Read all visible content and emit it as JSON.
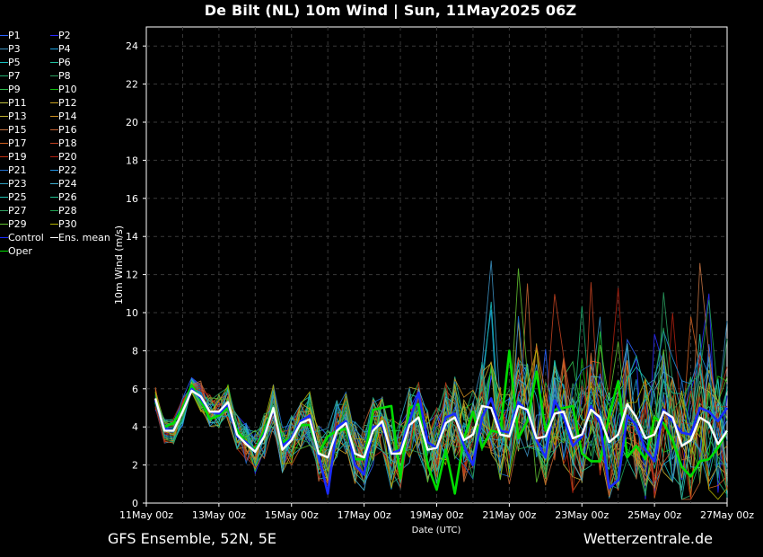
{
  "header": {
    "title": "De Bilt  (NL)  10m Wind | Sun, 11May2025 06Z"
  },
  "footer": {
    "left": "GFS Ensemble, 52N, 5E",
    "right": "Wetterzentrale.de"
  },
  "colors": {
    "background": "#000000",
    "grid": "#3a3a3a",
    "axis": "#ffffff",
    "control": "#1a2cff",
    "ensmean": "#ffffff",
    "oper": "#00dd00"
  },
  "chart_data": {
    "type": "line",
    "title": "De Bilt  (NL)  10m Wind | Sun, 11May2025 06Z",
    "xlabel": "Date (UTC)",
    "ylabel": "10m Wind (m/s)",
    "ylim": [
      0,
      25
    ],
    "y_ticks": [
      0,
      2,
      4,
      6,
      8,
      10,
      12,
      14,
      16,
      18,
      20,
      22,
      24
    ],
    "xlim": [
      0,
      64
    ],
    "x_unit": "6-hourly steps from 11May 00z",
    "x_ticks": [
      {
        "x": 0,
        "label": "11May 00z"
      },
      {
        "x": 8,
        "label": "13May 00z"
      },
      {
        "x": 16,
        "label": "15May 00z"
      },
      {
        "x": 24,
        "label": "17May 00z"
      },
      {
        "x": 32,
        "label": "19May 00z"
      },
      {
        "x": 40,
        "label": "21May 00z"
      },
      {
        "x": 48,
        "label": "23May 00z"
      },
      {
        "x": 56,
        "label": "25May 00z"
      },
      {
        "x": 64,
        "label": "27May 00z"
      }
    ],
    "grid": true,
    "legend_position": "left outside",
    "series": [
      {
        "name": "Ens. mean",
        "color": "#ffffff",
        "width": 2.4,
        "x": [
          1,
          2,
          3,
          4,
          5,
          6,
          7,
          8,
          9,
          10,
          11,
          12,
          13,
          14,
          15,
          16,
          17,
          18,
          19,
          20,
          21,
          22,
          23,
          24,
          25,
          26,
          27,
          28,
          29,
          30,
          31,
          32,
          33,
          34,
          35,
          36,
          37,
          38,
          39,
          40,
          41,
          42,
          43,
          44,
          45,
          46,
          47,
          48,
          49,
          50,
          51,
          52,
          53,
          54,
          55,
          56,
          57,
          58,
          59,
          60,
          61,
          62,
          63,
          64
        ],
        "values": [
          5.5,
          3.8,
          3.8,
          4.8,
          5.9,
          5.6,
          4.8,
          4.8,
          5.3,
          3.6,
          3.1,
          2.7,
          3.5,
          5.0,
          2.8,
          3.3,
          4.2,
          4.4,
          2.6,
          2.4,
          3.8,
          4.2,
          2.6,
          2.4,
          3.8,
          4.3,
          2.6,
          2.6,
          4.1,
          4.5,
          2.8,
          2.9,
          4.2,
          4.5,
          3.3,
          3.6,
          5.1,
          5.0,
          3.6,
          3.5,
          5.1,
          4.9,
          3.4,
          3.5,
          4.7,
          4.8,
          3.4,
          3.6,
          4.9,
          4.5,
          3.2,
          3.6,
          5.2,
          4.5,
          3.4,
          3.6,
          4.8,
          4.5,
          3.0,
          3.3,
          4.5,
          4.2,
          3.1,
          3.8
        ]
      },
      {
        "name": "Control",
        "color": "#1a2cff",
        "width": 2.6,
        "x": [
          1,
          2,
          3,
          4,
          5,
          6,
          7,
          8,
          9,
          10,
          11,
          12,
          13,
          14,
          15,
          16,
          17,
          18,
          19,
          20,
          21,
          22,
          23,
          24,
          25,
          26,
          27,
          28,
          29,
          30,
          31,
          32,
          33,
          34,
          35,
          36,
          37,
          38,
          39,
          40,
          41,
          42,
          43,
          44,
          45,
          46,
          47,
          48,
          49,
          50,
          51,
          52,
          53,
          54,
          55,
          56,
          57,
          58,
          59,
          60,
          61,
          62,
          63,
          64
        ],
        "values": [
          5.4,
          3.9,
          3.8,
          4.8,
          6.0,
          5.5,
          4.8,
          4.7,
          5.2,
          3.5,
          3.2,
          2.7,
          3.6,
          4.9,
          3.0,
          3.4,
          4.3,
          4.6,
          2.5,
          0.5,
          4.0,
          4.3,
          2.0,
          1.5,
          4.0,
          4.1,
          2.6,
          2.8,
          4.3,
          5.8,
          3.2,
          2.9,
          4.5,
          4.7,
          3.0,
          2.0,
          4.5,
          5.5,
          3.8,
          3.7,
          5.3,
          4.8,
          3.3,
          2.4,
          5.4,
          4.5,
          3.0,
          3.5,
          5.1,
          4.2,
          0.8,
          1.2,
          4.6,
          4.1,
          2.8,
          2.2,
          4.9,
          4.3,
          3.7,
          3.6,
          5.0,
          4.8,
          4.3,
          5.0
        ]
      },
      {
        "name": "Oper",
        "color": "#00dd00",
        "width": 2.6,
        "x": [
          1,
          2,
          3,
          4,
          5,
          6,
          7,
          8,
          9,
          10,
          11,
          12,
          13,
          14,
          15,
          16,
          17,
          18,
          19,
          20,
          21,
          22,
          23,
          24,
          25,
          26,
          27,
          28,
          29,
          30,
          31,
          32,
          33,
          34,
          35,
          36,
          37,
          38,
          39,
          40,
          41,
          42,
          43,
          44,
          45,
          46,
          47,
          48,
          49,
          50,
          51,
          52,
          53,
          54,
          55,
          56,
          57,
          58,
          59,
          60,
          61,
          62,
          63,
          64
        ],
        "values": [
          5.3,
          4.0,
          4.2,
          5.0,
          6.2,
          5.4,
          4.4,
          4.6,
          5.0,
          3.8,
          3.2,
          2.8,
          3.8,
          5.0,
          3.2,
          3.4,
          4.1,
          4.1,
          2.6,
          3.5,
          3.8,
          3.9,
          2.3,
          2.3,
          4.9,
          5.0,
          5.1,
          1.3,
          5.0,
          5.2,
          2.0,
          0.7,
          2.8,
          0.5,
          3.4,
          4.8,
          2.9,
          3.8,
          3.7,
          8.0,
          3.4,
          4.3,
          6.9,
          3.8,
          4.9,
          5.0,
          5.1,
          2.6,
          2.2,
          2.2,
          4.6,
          6.4,
          2.4,
          3.0,
          2.3,
          4.5,
          4.2,
          3.3,
          1.9,
          1.4,
          2.2,
          2.3,
          2.9,
          3.8
        ]
      }
    ]
  }
}
